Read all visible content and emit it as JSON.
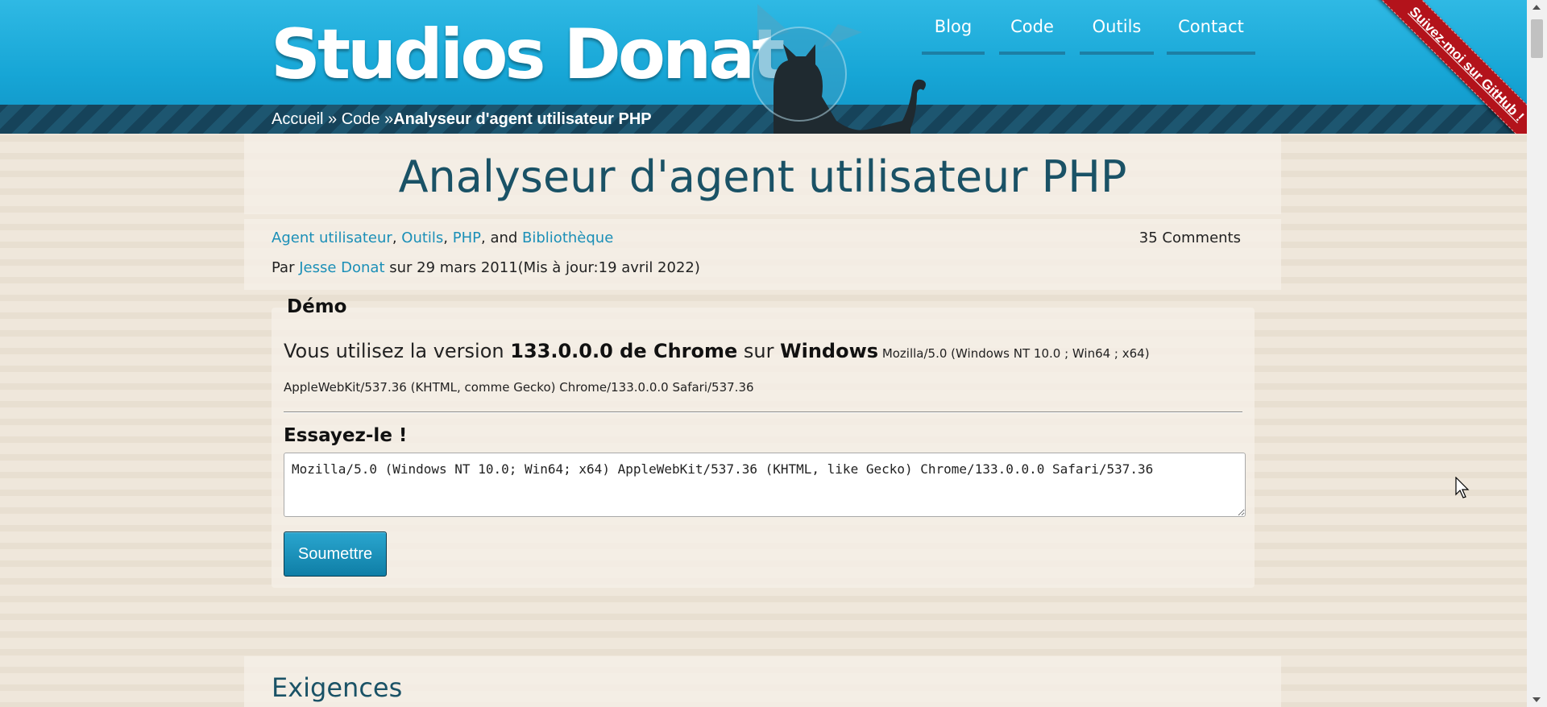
{
  "site": {
    "title": "Studios Donat"
  },
  "nav": {
    "items": [
      {
        "label": "Blog"
      },
      {
        "label": "Code"
      },
      {
        "label": "Outils"
      },
      {
        "label": "Contact"
      }
    ]
  },
  "ribbon": {
    "label": "Suivez-moi sur GitHub !"
  },
  "breadcrumb": {
    "home": "Accueil",
    "sep1": " » ",
    "code": "Code",
    "sep2": " »",
    "current": "Analyseur d'agent utilisateur PHP"
  },
  "article": {
    "title": "Analyseur d'agent utilisateur PHP",
    "tags": [
      "Agent utilisateur",
      "Outils",
      "PHP",
      "Bibliothèque"
    ],
    "tag_sep1": ", ",
    "tag_sep2": ", ",
    "tag_sep3": ", and ",
    "comments": "35 Comments",
    "byline_prefix": "Par ",
    "author": "Jesse Donat",
    "byline_date": " sur 29 mars 2011(Mis à jour:19 avril 2022)"
  },
  "demo": {
    "title": "Démo",
    "intro": "Vous utilisez la version ",
    "browser": "133.0.0.0 de Chrome",
    "sur": " sur ",
    "os": "Windows",
    "ua_line1": " Mozilla/5.0 (Windows NT 10.0 ; Win64 ; x64)",
    "ua_line2": "AppleWebKit/537.36 (KHTML, comme Gecko) Chrome/133.0.0.0 Safari/537.36",
    "try_title": "Essayez-le !",
    "input_value": "Mozilla/5.0 (Windows NT 10.0; Win64; x64) AppleWebKit/537.36 (KHTML, like Gecko) Chrome/133.0.0.0 Safari/537.36",
    "submit_label": "Soumettre"
  },
  "requirements": {
    "title": "Exigences"
  },
  "colors": {
    "header_blue": "#17a6d6",
    "link": "#1b8fb7",
    "heading": "#1a5266",
    "ribbon": "#b3131b"
  }
}
